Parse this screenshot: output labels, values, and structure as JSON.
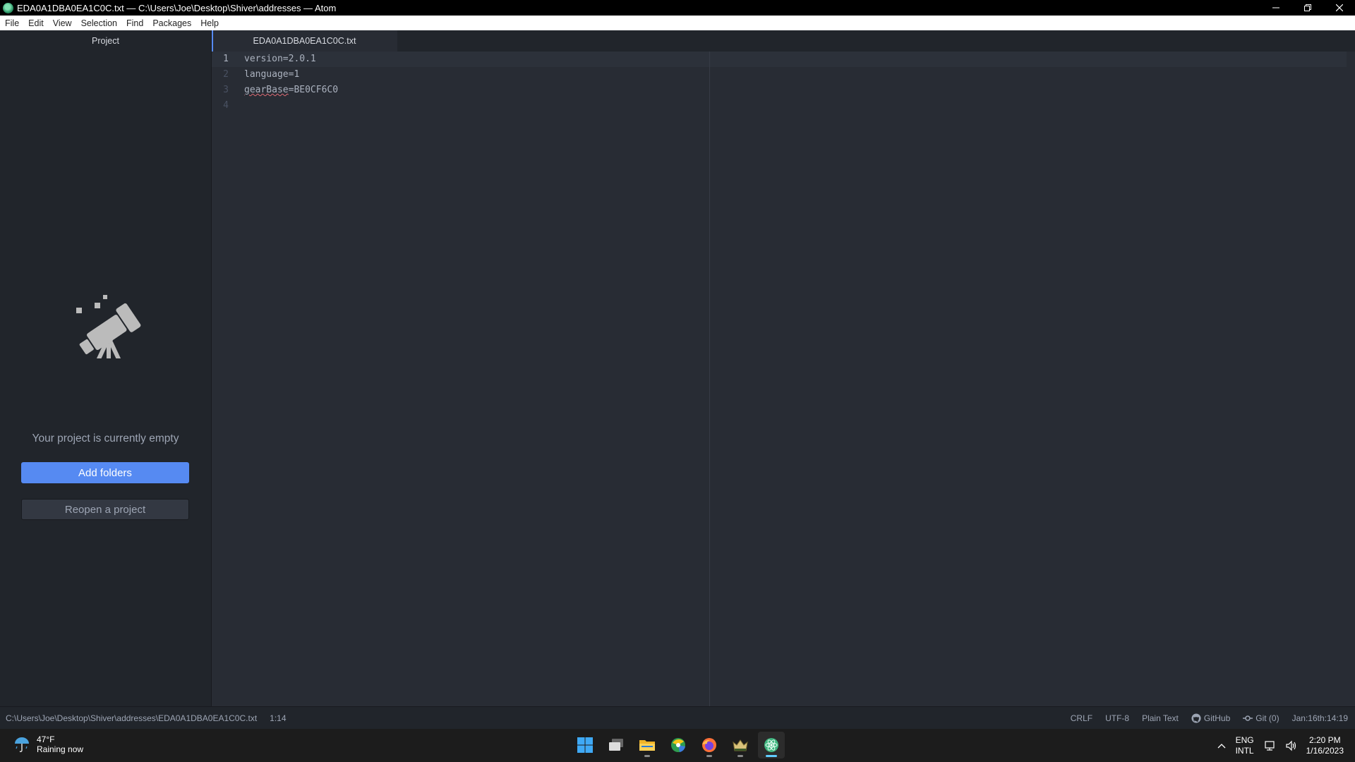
{
  "window": {
    "title": "EDA0A1DBA0EA1C0C.txt — C:\\Users\\Joe\\Desktop\\Shiver\\addresses — Atom"
  },
  "menu": [
    "File",
    "Edit",
    "View",
    "Selection",
    "Find",
    "Packages",
    "Help"
  ],
  "sidebar": {
    "tab_label": "Project",
    "empty_message": "Your project is currently empty",
    "add_folders_label": "Add folders",
    "reopen_label": "Reopen a project"
  },
  "editor": {
    "tab_label": "EDA0A1DBA0EA1C0C.txt",
    "lines": [
      {
        "number": "1",
        "text": "version=2.0.1"
      },
      {
        "number": "2",
        "text": "language=1"
      },
      {
        "number": "3",
        "misspelled": "gearBase",
        "rest": "=BE0CF6C0"
      },
      {
        "number": "4",
        "text": ""
      }
    ]
  },
  "status_bar": {
    "file_path": "C:\\Users\\Joe\\Desktop\\Shiver\\addresses\\EDA0A1DBA0EA1C0C.txt",
    "cursor_position": "1:14",
    "line_ending": "CRLF",
    "encoding": "UTF-8",
    "grammar": "Plain Text",
    "github": "GitHub",
    "git": "Git (0)",
    "timestamp": "Jan:16th:14:19"
  },
  "taskbar": {
    "weather_temp": "47°F",
    "weather_desc": "Raining now",
    "lang_line1": "ENG",
    "lang_line2": "INTL",
    "time": "2:20 PM",
    "date": "1/16/2023",
    "pinned_icons": [
      "windows-start-icon",
      "task-view-icon",
      "file-explorer-icon",
      "drive-app-icon",
      "firefox-icon",
      "game-app-icon",
      "atom-app-icon"
    ]
  },
  "colors": {
    "accent": "#568af2",
    "editor_bg": "#282c34",
    "panel_bg": "#21252b",
    "text": "#abb2bf"
  }
}
